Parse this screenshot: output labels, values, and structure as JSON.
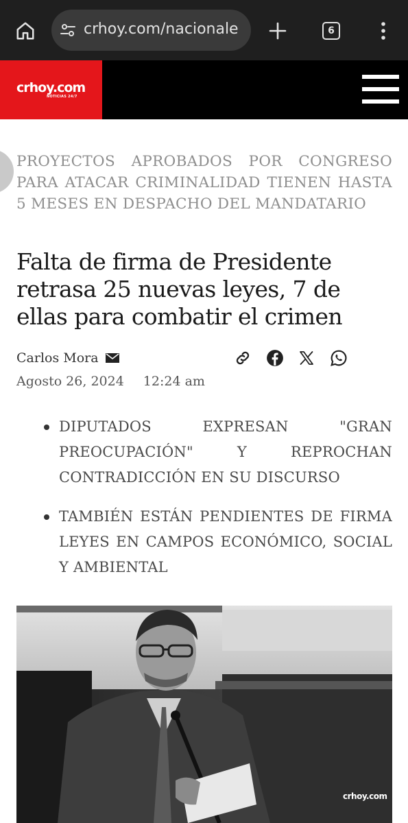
{
  "browser": {
    "url": "crhoy.com/nacionale",
    "tab_count": "6"
  },
  "site": {
    "logo_text": "crhoy.com",
    "logo_subtext": "NOTICIAS 24/7"
  },
  "article": {
    "kicker": "PROYECTOS APROBADOS POR CONGRESO PARA ATACAR CRIMINALIDAD TIENEN HASTA 5 MESES EN DESPACHO DEL MANDATARIO",
    "headline": "Falta de firma de Presidente retrasa 25 nuevas leyes, 7 de ellas para combatir el crimen",
    "author": "Carlos Mora",
    "date": "Agosto 26, 2024",
    "time": "12:24 am",
    "bullets": [
      "DIPUTADOS EXPRESAN \"GRAN PREOCUPACIÓN\" Y REPROCHAN CONTRADICCIÓN EN SU DISCURSO",
      "TAMBIÉN ESTÁN PENDIENTES DE FIRMA LEYES EN CAMPOS ECONÓMICO, SOCIAL Y AMBIENTAL"
    ],
    "photo_watermark": "crhoy.com"
  },
  "icons": {
    "home": "home-icon",
    "site_settings": "tune-icon",
    "new_tab": "plus-icon",
    "tabs": "tab-switcher-icon",
    "menu": "more-vert-icon",
    "hamburger": "hamburger-menu-icon",
    "mail": "mail-icon",
    "share": [
      "link-icon",
      "facebook-icon",
      "x-icon",
      "whatsapp-icon"
    ]
  },
  "colors": {
    "brand_red": "#e4161b",
    "chrome_bg": "#1f1f1f",
    "header_bg": "#000000",
    "kicker_text": "#8e8e8e"
  }
}
